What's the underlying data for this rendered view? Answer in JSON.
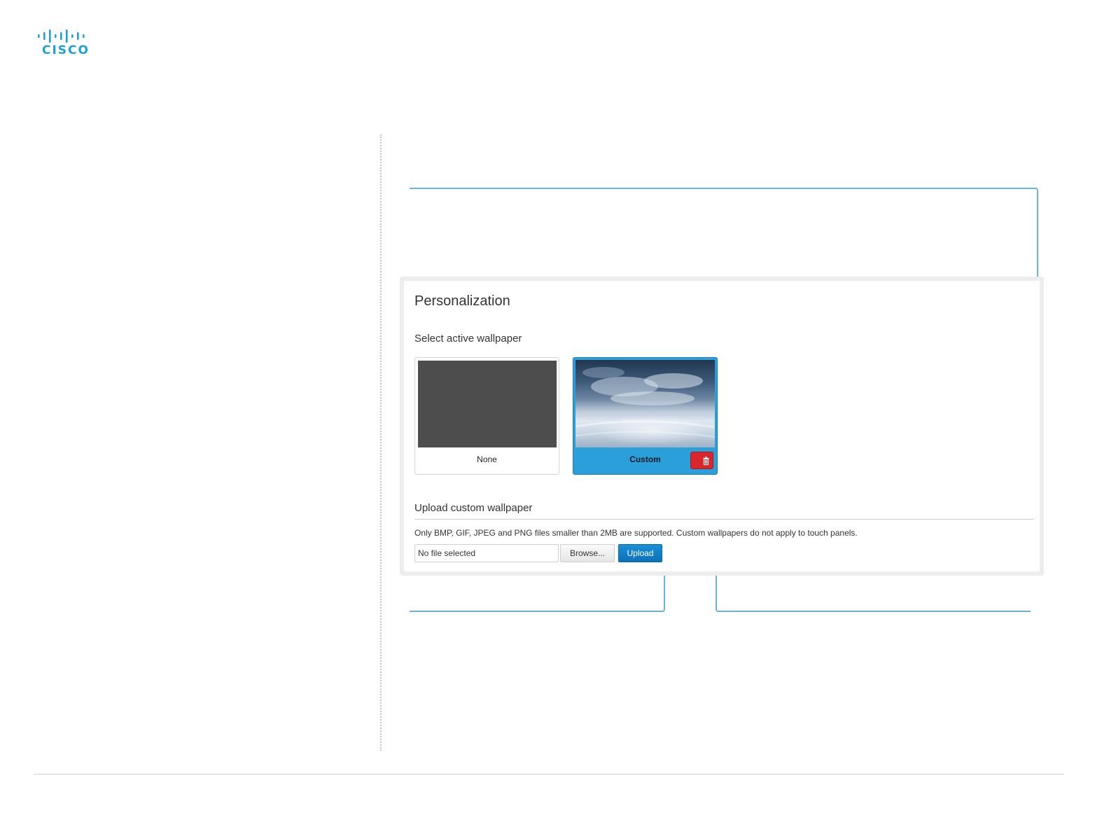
{
  "brand": {
    "logo_text": "CISCO",
    "logo_color": "#1ba0d7"
  },
  "personalization": {
    "title": "Personalization",
    "select_label": "Select active wallpaper",
    "wallpapers": [
      {
        "label": "None",
        "selected": false
      },
      {
        "label": "Custom",
        "selected": true,
        "action_icon": "trash-icon"
      }
    ],
    "upload": {
      "label": "Upload custom wallpaper",
      "help_text": "Only BMP, GIF, JPEG and PNG files smaller than 2MB are supported. Custom wallpapers do not apply to touch panels.",
      "file_value": "No file selected",
      "browse_label": "Browse...",
      "upload_label": "Upload"
    }
  },
  "colors": {
    "accent": "#2a9fd9",
    "callout": "#6bb2d8",
    "delete": "#d9262c"
  }
}
